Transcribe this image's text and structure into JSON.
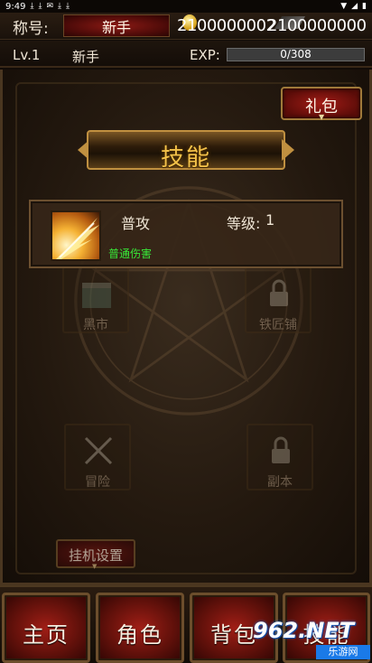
{
  "status_bar": {
    "time": "9:49",
    "left_icons": [
      "download-icon",
      "download-icon",
      "mail-icon",
      "download-icon",
      "download-icon"
    ],
    "right_icons": [
      "wifi-icon",
      "signal-icon",
      "battery-icon"
    ]
  },
  "header": {
    "title_label": "称号:",
    "rank_title": "新手",
    "currency1": "2100000002",
    "currency2": "2100000000",
    "level": "Lv.1",
    "player_name": "新手",
    "exp_label": "EXP:",
    "exp_text": "0/308",
    "exp_progress": 0
  },
  "gift_button": {
    "label": "礼包"
  },
  "skill_panel": {
    "title": "技能",
    "skills": [
      {
        "name": "普攻",
        "level_label": "等级:",
        "level": "1",
        "description": "普通伤害"
      }
    ]
  },
  "background_tiles": [
    {
      "label": "黑市"
    },
    {
      "label": "铁匠铺"
    },
    {
      "label": "冒险"
    },
    {
      "label": "副本"
    }
  ],
  "idle_button": {
    "label": "挂机设置"
  },
  "bottom_nav": [
    {
      "label": "主页"
    },
    {
      "label": "角色"
    },
    {
      "label": "背包"
    },
    {
      "label": "技能"
    }
  ],
  "watermark": {
    "logo": "962.NET",
    "sub": "乐游网"
  },
  "colors": {
    "accent_gold": "#f4c24a",
    "button_red": "#a01e16",
    "description_green": "#38e838"
  }
}
